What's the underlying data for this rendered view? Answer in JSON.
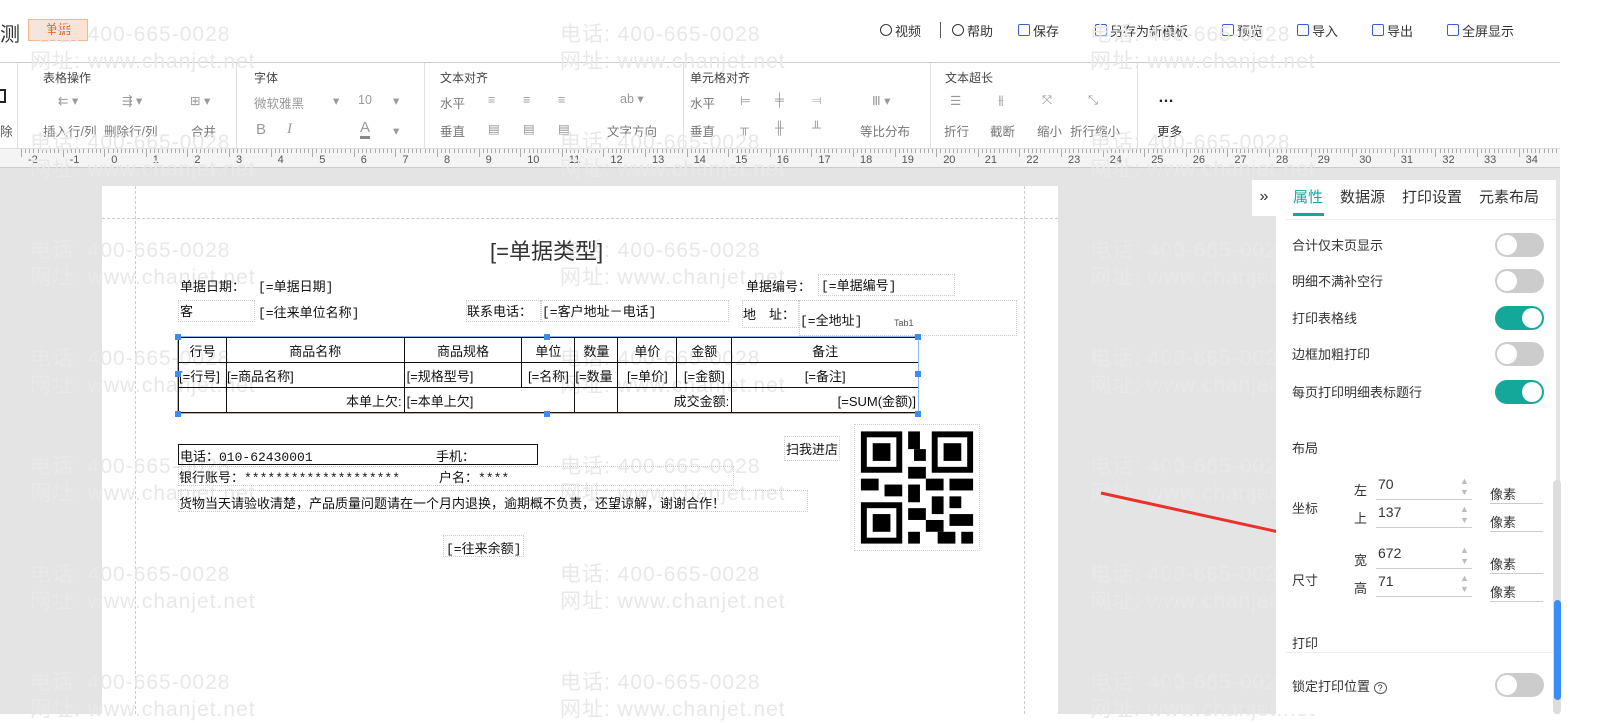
{
  "header": {
    "title": "测",
    "badge": "单据",
    "buttons": [
      {
        "label": "视频"
      },
      {
        "label": "帮助"
      },
      {
        "label": "保存"
      },
      {
        "label": "另存为新模板"
      },
      {
        "label": "预览"
      },
      {
        "label": "导入"
      },
      {
        "label": "导出"
      },
      {
        "label": "全屏显示"
      }
    ]
  },
  "toolbar": {
    "left_partial": "除",
    "table_ops": {
      "label": "表格操作",
      "insert": "插入行/列",
      "delete": "删除行/列",
      "merge": "合并"
    },
    "font": {
      "label": "字体",
      "family": "微软雅黑",
      "size": "10",
      "bold": "B",
      "italic": "I",
      "color": "A"
    },
    "text_align": {
      "label": "文本对齐",
      "horizontal": "水平",
      "vertical": "垂直",
      "direction": "文字方向"
    },
    "cell_align": {
      "label": "单元格对齐",
      "horizontal": "水平",
      "vertical": "垂直",
      "distribute": "等比分布"
    },
    "overflow": {
      "label": "文本超长",
      "wrap": "折行",
      "truncate": "截断",
      "shrink": "缩小",
      "wrap_shrink": "折行缩小"
    },
    "more": {
      "dots": "…",
      "label": "更多"
    }
  },
  "ruler": {
    "start": -2,
    "end": 34
  },
  "watermark": {
    "phone": "电话: 400-665-0028",
    "site": "网址: www.chanjet.net"
  },
  "paper": {
    "title": "[=单据类型]",
    "date_label": "单据日期：",
    "date_value": "[=单据日期]",
    "number_label": "单据编号：",
    "number_value": "[=单据编号]",
    "customer_label": "客",
    "customer_value": "[=往来单位名称]",
    "phone_label": "联系电话：",
    "phone_value": "[=客户地址－电话]",
    "address_label": "地　址：",
    "address_value": "[=全地址]",
    "tab_tag": "Tab1",
    "table": {
      "headers": [
        "行号",
        "商品名称",
        "商品规格",
        "单位",
        "数量",
        "单价",
        "金额",
        "备注"
      ],
      "row": [
        "[=行号]",
        "[=商品名称]",
        "[=规格型号]",
        "[=名称]",
        "[=数量",
        "[=单价]",
        "[=金额]",
        "[=备注]"
      ],
      "footer": {
        "owe_label": "本单上欠:",
        "owe_value": "[=本单上欠]",
        "deal_label": "成交金额:",
        "deal_value": "[=SUM(金额)]"
      }
    },
    "tel": "电话：010-62430001",
    "mobile": "手机：",
    "bank": "银行账号：********************",
    "account_name": "户名：****",
    "notice": "货物当天请验收清楚，产品质量问题请在一个月内退换，逾期概不负责，还望谅解，谢谢合作！",
    "balance": "[=往来余额]",
    "qr_label": "扫我进店"
  },
  "panel": {
    "tabs": [
      "属性",
      "数据源",
      "打印设置",
      "元素布局"
    ],
    "toggles": [
      {
        "label": "合计仅末页显示",
        "on": false
      },
      {
        "label": "明细不满补空行",
        "on": false
      },
      {
        "label": "打印表格线",
        "on": true
      },
      {
        "label": "边框加粗打印",
        "on": false
      },
      {
        "label": "每页打印明细表标题行",
        "on": true
      }
    ],
    "layout_title": "布局",
    "coord_label": "坐标",
    "left_label": "左",
    "left_value": "70",
    "top_label": "上",
    "top_value": "137",
    "size_label": "尺寸",
    "width_label": "宽",
    "width_value": "672",
    "height_label": "高",
    "height_value": "71",
    "unit": "像素",
    "print_title": "打印",
    "lock_label": "锁定打印位置",
    "lock_on": false
  },
  "colors": {
    "accent": "#14a89a",
    "badge": "#e86a2a",
    "selection": "#3b8df5",
    "arrow": "#e8322a"
  }
}
